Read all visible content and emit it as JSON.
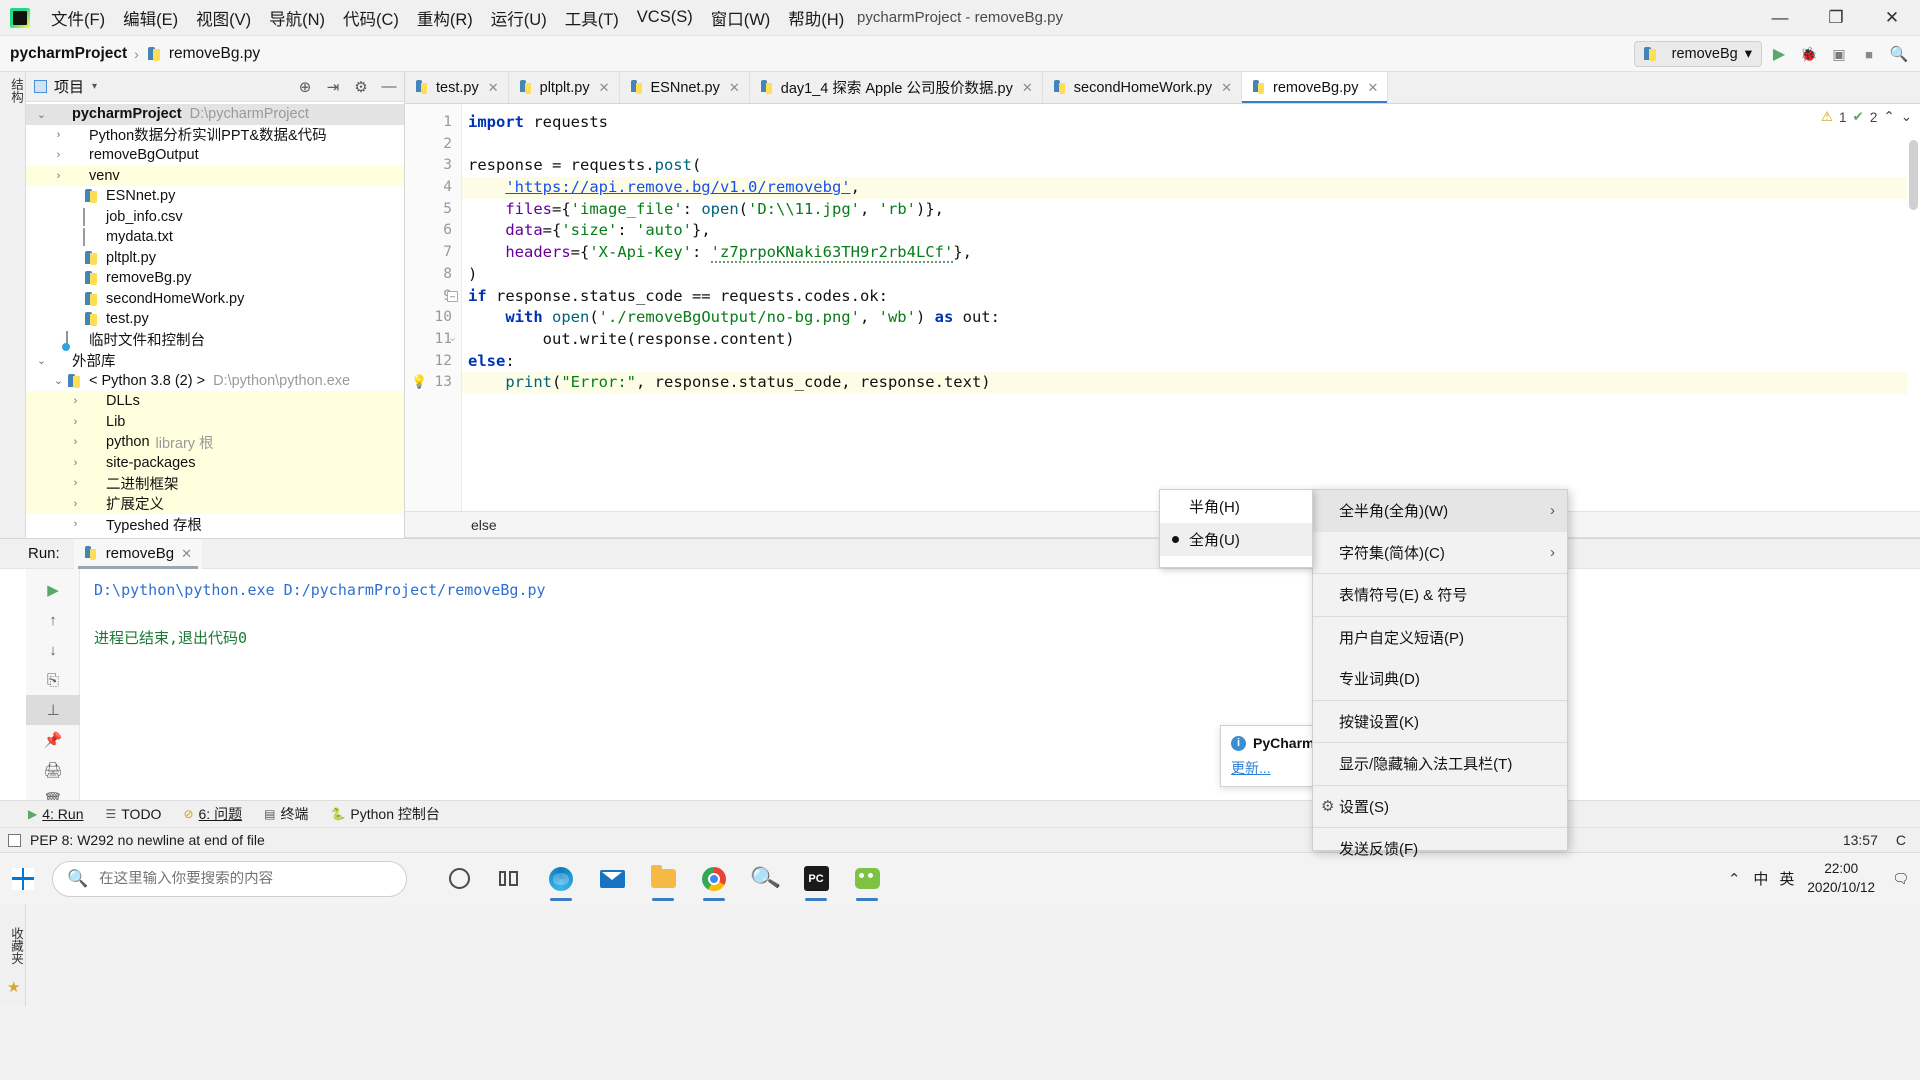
{
  "titlebar": {
    "menus": [
      "文件(F)",
      "编辑(E)",
      "视图(V)",
      "导航(N)",
      "代码(C)",
      "重构(R)",
      "运行(U)",
      "工具(T)",
      "VCS(S)",
      "窗口(W)",
      "帮助(H)"
    ],
    "window_title": "pycharmProject - removeBg.py",
    "minimize": "—",
    "maximize": "❐",
    "close": "✕"
  },
  "navbar": {
    "project_crumb": "pycharmProject",
    "separator": "›",
    "file_crumb": "removeBg.py",
    "run_config": "removeBg",
    "run_caret": "▾",
    "buttons": {
      "run": "▶",
      "debug": "🐞",
      "coverage": "▣",
      "stop": "■",
      "search": "🔍"
    }
  },
  "left_rail": {
    "top_label": "结构",
    "bottom_labels": [
      "2: 结构",
      "收藏夹"
    ]
  },
  "project_panel": {
    "title": "项目",
    "caret": "▾",
    "tools": [
      "⊕",
      "⇥",
      "⚙",
      "—"
    ],
    "tree": [
      {
        "indent": 0,
        "arrow": "⌄",
        "icon": "folder",
        "label": "pycharmProject",
        "bold": true,
        "dim": "D:\\pycharmProject",
        "sel": "grey"
      },
      {
        "indent": 1,
        "arrow": "›",
        "icon": "folder",
        "label": "Python数据分析实训PPT&数据&代码",
        "bold": false,
        "dim": "",
        "sel": ""
      },
      {
        "indent": 1,
        "arrow": "›",
        "icon": "folder",
        "label": "removeBgOutput",
        "bold": false,
        "dim": "",
        "sel": ""
      },
      {
        "indent": 1,
        "arrow": "›",
        "icon": "folder-orange",
        "label": "venv",
        "bold": false,
        "dim": "",
        "sel": "yellow"
      },
      {
        "indent": 2,
        "arrow": "",
        "icon": "py",
        "label": "ESNnet.py",
        "bold": false,
        "dim": "",
        "sel": ""
      },
      {
        "indent": 2,
        "arrow": "",
        "icon": "file",
        "label": "job_info.csv",
        "bold": false,
        "dim": "",
        "sel": ""
      },
      {
        "indent": 2,
        "arrow": "",
        "icon": "file",
        "label": "mydata.txt",
        "bold": false,
        "dim": "",
        "sel": ""
      },
      {
        "indent": 2,
        "arrow": "",
        "icon": "py",
        "label": "pltplt.py",
        "bold": false,
        "dim": "",
        "sel": ""
      },
      {
        "indent": 2,
        "arrow": "",
        "icon": "py",
        "label": "removeBg.py",
        "bold": false,
        "dim": "",
        "sel": ""
      },
      {
        "indent": 2,
        "arrow": "",
        "icon": "py",
        "label": "secondHomeWork.py",
        "bold": false,
        "dim": "",
        "sel": ""
      },
      {
        "indent": 2,
        "arrow": "",
        "icon": "py",
        "label": "test.py",
        "bold": false,
        "dim": "",
        "sel": ""
      },
      {
        "indent": 1,
        "arrow": "",
        "icon": "console",
        "label": "临时文件和控制台",
        "bold": false,
        "dim": "",
        "sel": ""
      },
      {
        "indent": 0,
        "arrow": "⌄",
        "icon": "lib",
        "label": "外部库",
        "bold": false,
        "dim": "",
        "sel": ""
      },
      {
        "indent": 1,
        "arrow": "⌄",
        "icon": "py",
        "label": "< Python 3.8 (2) >",
        "bold": false,
        "dim": "D:\\python\\python.exe",
        "sel": ""
      },
      {
        "indent": 2,
        "arrow": "›",
        "icon": "folder",
        "label": "DLLs",
        "bold": false,
        "dim": "",
        "sel": "yellow"
      },
      {
        "indent": 2,
        "arrow": "›",
        "icon": "folder",
        "label": "Lib",
        "bold": false,
        "dim": "",
        "sel": "yellow"
      },
      {
        "indent": 2,
        "arrow": "›",
        "icon": "folder",
        "label": "python",
        "bold": false,
        "dim": "library 根",
        "sel": "yellow"
      },
      {
        "indent": 2,
        "arrow": "›",
        "icon": "folder",
        "label": "site-packages",
        "bold": false,
        "dim": "",
        "sel": "yellow"
      },
      {
        "indent": 2,
        "arrow": "›",
        "icon": "lib",
        "label": "二进制框架",
        "bold": false,
        "dim": "",
        "sel": "yellow"
      },
      {
        "indent": 2,
        "arrow": "›",
        "icon": "lib",
        "label": "扩展定义",
        "bold": false,
        "dim": "",
        "sel": "yellow"
      },
      {
        "indent": 2,
        "arrow": "›",
        "icon": "lib",
        "label": "Typeshed 存根",
        "bold": false,
        "dim": "",
        "sel": ""
      }
    ]
  },
  "editor": {
    "tabs": [
      {
        "label": "test.py",
        "active": false
      },
      {
        "label": "pltplt.py",
        "active": false
      },
      {
        "label": "ESNnet.py",
        "active": false
      },
      {
        "label": "day1_4 探索 Apple 公司股价数据.py",
        "active": false
      },
      {
        "label": "secondHomeWork.py",
        "active": false
      },
      {
        "label": "removeBg.py",
        "active": true
      }
    ],
    "tab_close": "✕",
    "line_numbers": [
      "1",
      "2",
      "3",
      "4",
      "5",
      "6",
      "7",
      "8",
      "9",
      "10",
      "11",
      "12",
      "13"
    ],
    "code_lines": [
      "import requests",
      "",
      "response = requests.post(",
      "    'https://api.remove.bg/v1.0/removebg',",
      "    files={'image_file': open('D:\\\\11.jpg', 'rb')},",
      "    data={'size': 'auto'},",
      "    headers={'X-Api-Key': 'z7prpoKNaki63TH9r2rb4LCf'},",
      ")",
      "if response.status_code == requests.codes.ok:",
      "    with open('./removeBgOutput/no-bg.png', 'wb') as out:",
      "        out.write(response.content)",
      "else:",
      "    print(\"Error:\", response.status_code, response.text)"
    ],
    "inspections": {
      "warning_count": "1",
      "ok_count": "2",
      "warning_icon": "⚠",
      "ok_icon": "✔",
      "up_arrow": "⌃",
      "down_arrow": "⌄"
    },
    "bottom_breadcrumb": "else"
  },
  "run_panel": {
    "label": "Run:",
    "tab": "removeBg",
    "tab_close": "✕",
    "toolbar": [
      "▶",
      "↑",
      "↓",
      "⇤",
      "⎘",
      "⊥",
      "📌",
      "🖨",
      "🗑"
    ],
    "console_command": "D:\\python\\python.exe D:/pycharmProject/removeBg.py",
    "console_result": "进程已结束,退出代码0"
  },
  "bottom_bar": {
    "items": [
      {
        "icon": "▶",
        "label": "4: Run",
        "underline": true
      },
      {
        "icon": "☰",
        "label": "TODO",
        "underline": false
      },
      {
        "icon": "⊘",
        "label": "6: 问题",
        "underline": true
      },
      {
        "icon": "▤",
        "label": "终端",
        "underline": false
      },
      {
        "icon": "🐍",
        "label": "Python 控制台",
        "underline": false
      }
    ]
  },
  "statusbar": {
    "message": "PEP 8: W292 no newline at end of file",
    "time": "13:57",
    "extra": "C"
  },
  "balloon": {
    "title": "PyCharm2",
    "info_icon": "i",
    "link": "更新..."
  },
  "ime_submenu": {
    "items": [
      {
        "label": "半角(H)",
        "checked": false
      },
      {
        "label": "全角(U)",
        "checked": true
      }
    ]
  },
  "ime_menu": {
    "items": [
      {
        "label": "全半角(全角)(W)",
        "chevron": "›",
        "gear": false,
        "highlight": true
      },
      {
        "label": "字符集(简体)(C)",
        "chevron": "›",
        "gear": false,
        "highlight": false
      },
      {
        "label": "表情符号(E) & 符号",
        "chevron": "",
        "gear": false,
        "highlight": false
      },
      {
        "label": "用户自定义短语(P)",
        "chevron": "",
        "gear": false,
        "highlight": false
      },
      {
        "label": "专业词典(D)",
        "chevron": "",
        "gear": false,
        "highlight": false
      },
      {
        "label": "按键设置(K)",
        "chevron": "",
        "gear": false,
        "highlight": false
      },
      {
        "label": "显示/隐藏输入法工具栏(T)",
        "chevron": "",
        "gear": false,
        "highlight": false
      },
      {
        "label": "设置(S)",
        "chevron": "",
        "gear": true,
        "highlight": false
      },
      {
        "label": "发送反馈(F)",
        "chevron": "",
        "gear": false,
        "highlight": false
      }
    ]
  },
  "taskbar": {
    "search_placeholder": "在这里输入你要搜索的内容",
    "icons": [
      "cortana-circle-icon",
      "task-view-icon",
      "edge-icon",
      "mail-icon",
      "file-explorer-icon",
      "chrome-icon",
      "search-magnifier-icon",
      "pycharm-icon",
      "wechat-icon"
    ],
    "tray": {
      "chevron": "⌃",
      "ime_mode": "中",
      "ime_lang": "英",
      "time": "22:00",
      "date": "2020/10/12",
      "notification": "🗨"
    }
  }
}
